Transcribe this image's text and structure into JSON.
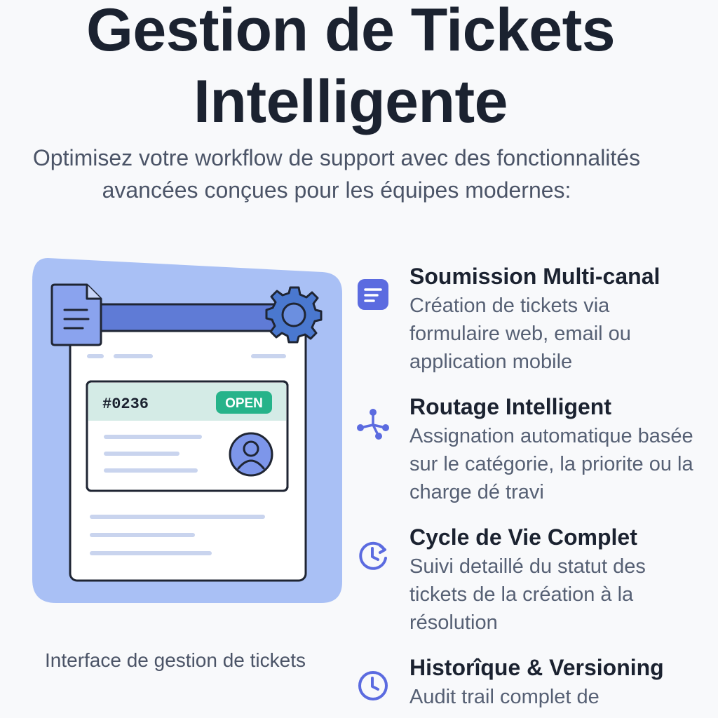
{
  "header": {
    "title_line1": "Gestion de Tickets",
    "title_line2": "Intelligente",
    "subtitle": "Optimisez votre workflow de support avec des fonctionnalités avancées conçues pour les équipes modernes:"
  },
  "illustration": {
    "ticket_number": "#0236",
    "status_badge": "OPEN",
    "caption": "Interface de gestion de tickets",
    "icons": [
      "document-icon",
      "gear-icon",
      "user-avatar-icon"
    ],
    "colors": {
      "backdrop": "#a9c0f5",
      "bar": "#5f7bd6",
      "ticket_header": "#d4ebe6",
      "badge": "#26b38a",
      "avatar": "#7d96ea"
    }
  },
  "features": [
    {
      "icon": "list-icon",
      "title": "Soumission Multi-canal",
      "description": "Création de tickets via formulaire web, email ou application mobile"
    },
    {
      "icon": "routing-icon",
      "title": "Routage Intelligent",
      "description": "Assignation automatique basée sur le catégorie, la priorite ou la charge dé travi"
    },
    {
      "icon": "lifecycle-clock-icon",
      "title": "Cycle de Vie Complet",
      "description": "Suivi detaillé du statut des tickets de la création à la résolution"
    },
    {
      "icon": "clock-icon",
      "title": "Historîque & Versioning",
      "description": "Audit trail complet de"
    }
  ],
  "accent_color": "#5b6be0"
}
